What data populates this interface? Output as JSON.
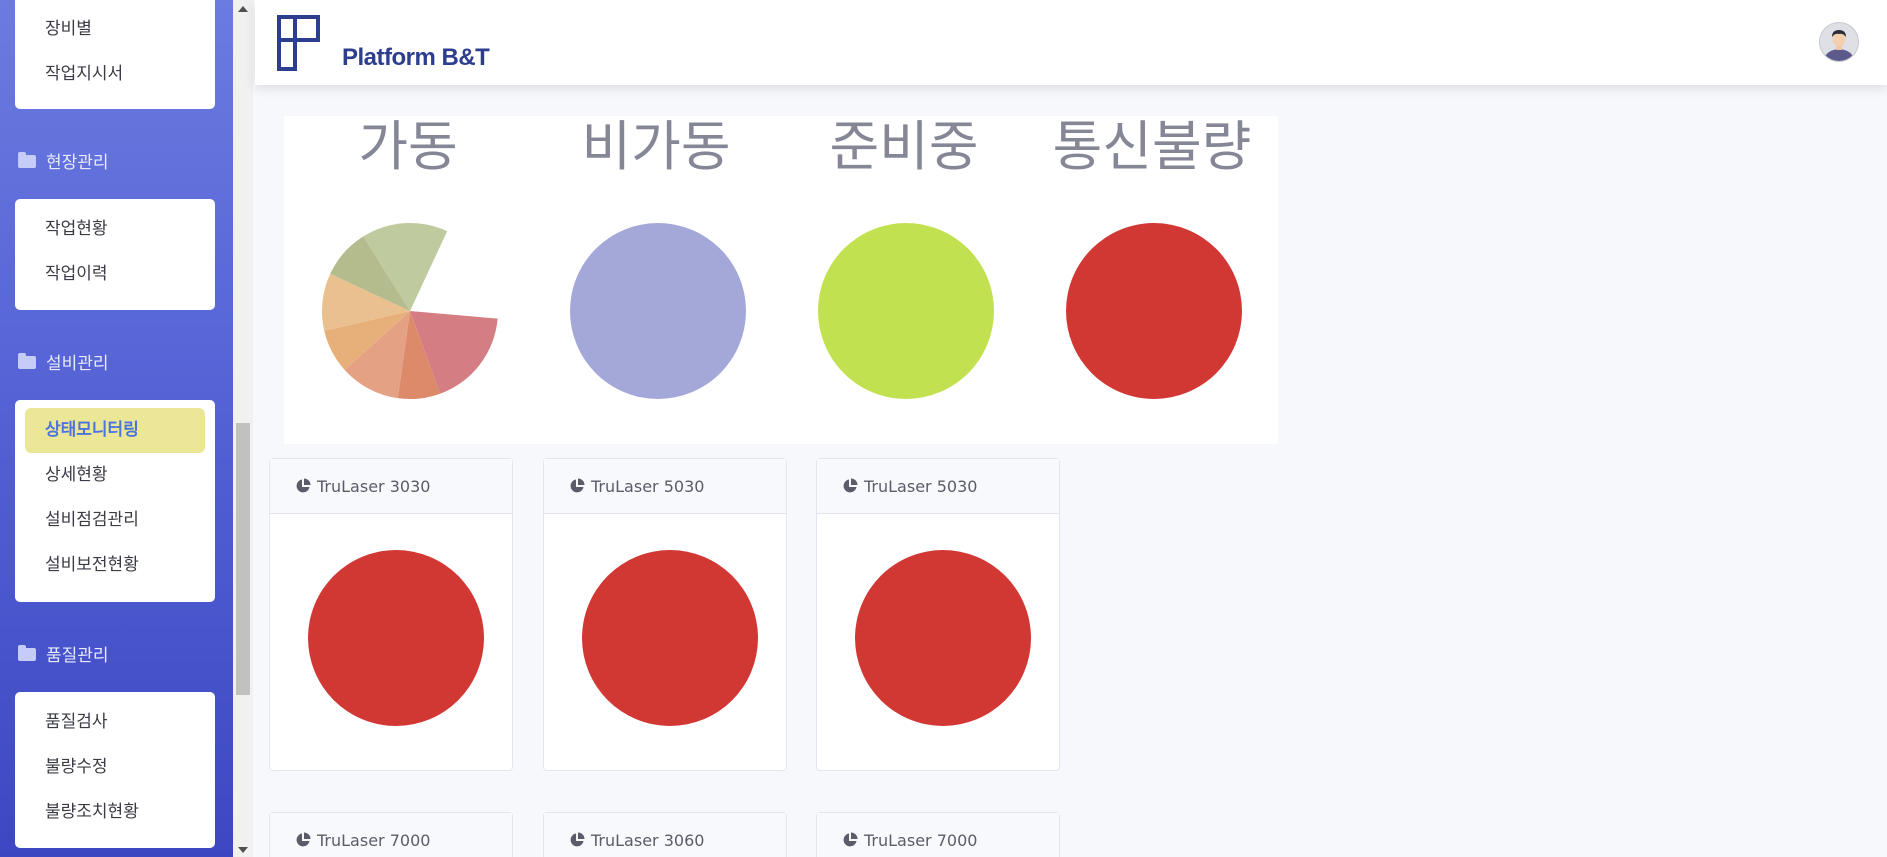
{
  "sidebar": {
    "top_items": [
      {
        "label": "장비별"
      },
      {
        "label": "작업지시서"
      }
    ],
    "sections": [
      {
        "title": "현장관리",
        "items": [
          {
            "label": "작업현황"
          },
          {
            "label": "작업이력"
          }
        ]
      },
      {
        "title": "설비관리",
        "items": [
          {
            "label": "상태모니터링",
            "active": true
          },
          {
            "label": "상세현황"
          },
          {
            "label": "설비점검관리"
          },
          {
            "label": "설비보전현황"
          }
        ]
      },
      {
        "title": "품질관리",
        "items": [
          {
            "label": "품질검사"
          },
          {
            "label": "불량수정"
          },
          {
            "label": "불량조치현황"
          }
        ]
      }
    ]
  },
  "header": {
    "logo_text": "Platform B&T",
    "logo_color": "#2e3e8f"
  },
  "status_summary": [
    {
      "label": "가동",
      "chart": "multi-slice-pie"
    },
    {
      "label": "비가동",
      "color": "#a3a8d9"
    },
    {
      "label": "준비중",
      "color": "#c1e151"
    },
    {
      "label": "통신불량",
      "color": "#d13733"
    }
  ],
  "machines": [
    {
      "name": "TruLaser 3030",
      "status_color": "#d13733"
    },
    {
      "name": "TruLaser 5030",
      "status_color": "#d13733"
    },
    {
      "name": "TruLaser 5030",
      "status_color": "#d13733"
    },
    {
      "name": "TruLaser 7000"
    },
    {
      "name": "TruLaser 3060"
    },
    {
      "name": "TruLaser 7000"
    }
  ],
  "icons": {
    "folder": "folder-icon",
    "machine_header": "pie-chart-icon",
    "avatar": "user-avatar"
  }
}
